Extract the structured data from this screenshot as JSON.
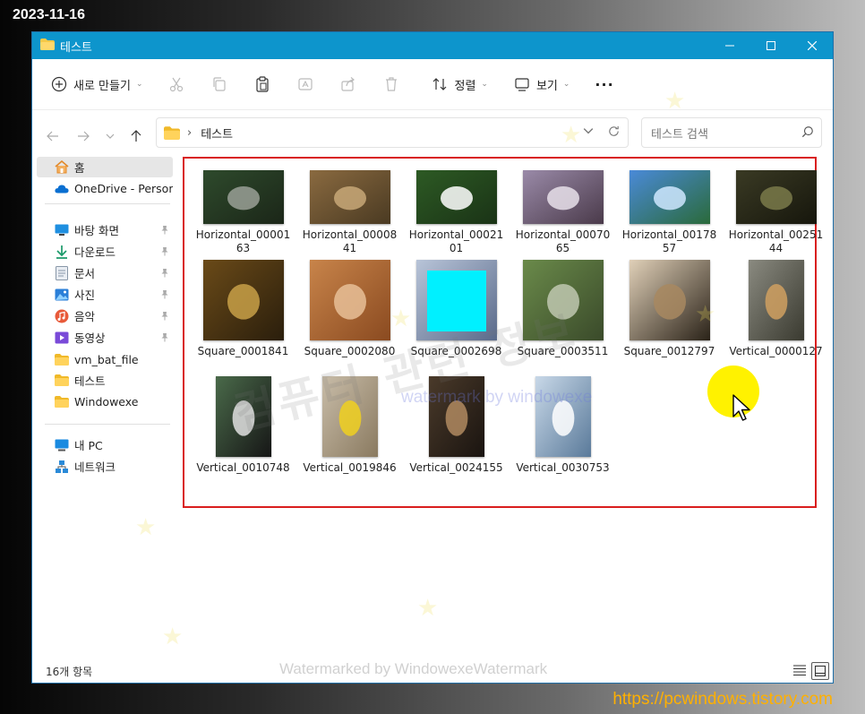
{
  "date_stamp": "2023-11-16",
  "site_url": "https://pcwindows.tistory.com",
  "window": {
    "title": "테스트",
    "controls": {
      "minimize_icon": "minimize-icon",
      "maximize_icon": "maximize-icon",
      "close_icon": "close-icon"
    }
  },
  "toolbar": {
    "new_label": "새로 만들기",
    "sort_label": "정렬",
    "view_label": "보기",
    "more_label": "···"
  },
  "address": {
    "folder": "테스트",
    "separator": "›"
  },
  "search": {
    "placeholder": "테스트 검색"
  },
  "sidebar": {
    "items": [
      {
        "label": "홈",
        "icon": "home-icon",
        "pinned": false,
        "selected": true
      },
      {
        "label": "OneDrive - Personal",
        "icon": "cloud-icon",
        "pinned": false
      },
      {
        "label": "바탕 화면",
        "icon": "desktop-icon",
        "pinned": true
      },
      {
        "label": "다운로드",
        "icon": "download-icon",
        "pinned": true
      },
      {
        "label": "문서",
        "icon": "document-icon",
        "pinned": true
      },
      {
        "label": "사진",
        "icon": "picture-icon",
        "pinned": true
      },
      {
        "label": "음악",
        "icon": "music-icon",
        "pinned": true
      },
      {
        "label": "동영상",
        "icon": "video-icon",
        "pinned": true
      },
      {
        "label": "vm_bat_file",
        "icon": "folder-icon",
        "pinned": false
      },
      {
        "label": "테스트",
        "icon": "folder-icon",
        "pinned": false
      },
      {
        "label": "Windowexe",
        "icon": "folder-icon",
        "pinned": false
      },
      {
        "label": "내 PC",
        "icon": "pc-icon",
        "pinned": false
      },
      {
        "label": "네트워크",
        "icon": "network-icon",
        "pinned": false
      }
    ]
  },
  "files": [
    {
      "name": "Horizontal_0000163",
      "shape": "h",
      "colors": [
        "#2e4a2c",
        "#1b2618",
        "#9aa096"
      ]
    },
    {
      "name": "Horizontal_0000841",
      "shape": "h",
      "colors": [
        "#8a6a40",
        "#4a3a22",
        "#c8a878"
      ]
    },
    {
      "name": "Horizontal_0002101",
      "shape": "h",
      "colors": [
        "#2d5a24",
        "#1a3316",
        "#ffffff"
      ]
    },
    {
      "name": "Horizontal_0007065",
      "shape": "h",
      "colors": [
        "#9a8aa8",
        "#4a3a4a",
        "#e8e0ea"
      ]
    },
    {
      "name": "Horizontal_0017857",
      "shape": "h",
      "colors": [
        "#4a8ad8",
        "#2a6a3a",
        "#cfe8ff"
      ]
    },
    {
      "name": "Horizontal_0025144",
      "shape": "h",
      "colors": [
        "#3a3a24",
        "#16160c",
        "#7a7a4a"
      ]
    },
    {
      "name": "Square_0001841",
      "shape": "s",
      "colors": [
        "#6a4a18",
        "#2a1e0c",
        "#c8a048"
      ]
    },
    {
      "name": "Square_0002080",
      "shape": "s",
      "colors": [
        "#c8844a",
        "#8a4a20",
        "#e8c098"
      ]
    },
    {
      "name": "Square_0002698",
      "shape": "s",
      "colors": [
        "#b8c4d8",
        "#5a6a8a",
        "#00f0ff"
      ]
    },
    {
      "name": "Square_0003511",
      "shape": "s",
      "colors": [
        "#6a8a4a",
        "#3a4a2a",
        "#c0c8b0"
      ]
    },
    {
      "name": "Square_0012797",
      "shape": "s",
      "colors": [
        "#e0d0b8",
        "#2a2218",
        "#a88860"
      ]
    },
    {
      "name": "Vertical_0000127",
      "shape": "v",
      "colors": [
        "#8a8a80",
        "#3a3a30",
        "#d0a060"
      ]
    },
    {
      "name": "Vertical_0010748",
      "shape": "v",
      "colors": [
        "#4a6a4a",
        "#161616",
        "#e0e0e0"
      ]
    },
    {
      "name": "Vertical_0019846",
      "shape": "v",
      "colors": [
        "#c8bca8",
        "#8a7a60",
        "#f0d020"
      ]
    },
    {
      "name": "Vertical_0024155",
      "shape": "v",
      "colors": [
        "#4a3a2a",
        "#1a1410",
        "#b08a60"
      ]
    },
    {
      "name": "Vertical_0030753",
      "shape": "v",
      "colors": [
        "#c8d8e8",
        "#5a7a9a",
        "#ffffff"
      ]
    }
  ],
  "status": {
    "item_count": "16개 항목"
  },
  "watermarks": {
    "korean": "컴퓨터 관련 정보",
    "english": "watermark by windowexe",
    "bottom": "Watermarked by WindowexeWatermark"
  },
  "colors": {
    "title_bar": "#0d95cc",
    "selection_outline": "#d91e1e",
    "cursor_highlight": "#fff200",
    "url": "#ffb000"
  }
}
